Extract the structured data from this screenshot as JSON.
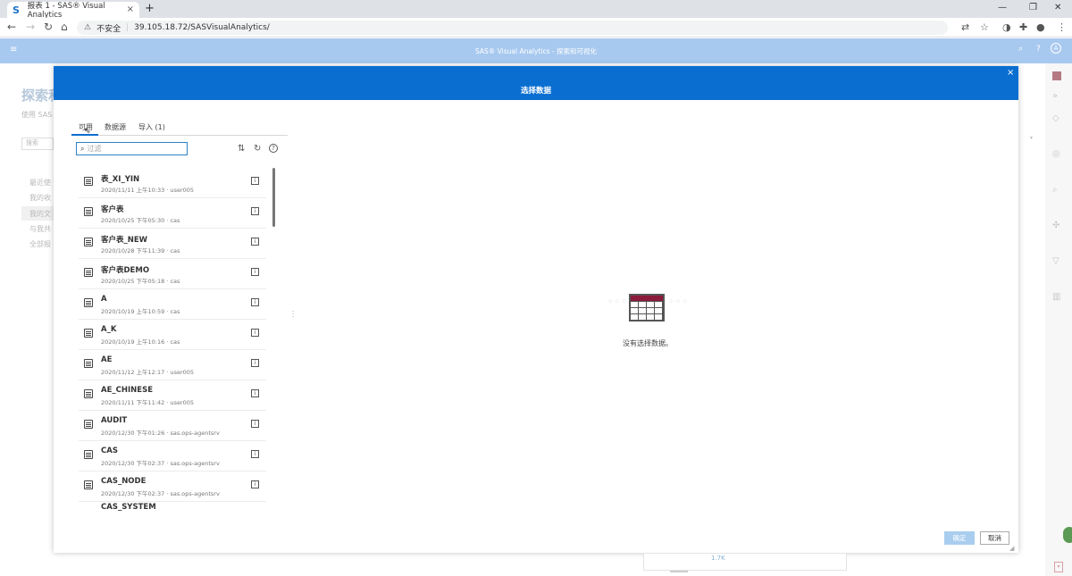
{
  "browser": {
    "tab_title": "报表 1 - SAS® Visual Analytics",
    "tab_close": "×",
    "new_tab": "+",
    "favicon": "S",
    "security_warning": "不安全",
    "url": "39.105.18.72/SASVisualAnalytics/",
    "window_controls": [
      "—",
      "❐",
      "✕"
    ]
  },
  "app": {
    "header_title": "SAS® Visual Analytics - 探索和可视化",
    "background_title": "探索和",
    "background_subtitle": "使用 SAS",
    "background_search": "搜索",
    "background_nav": [
      "最近使",
      "我的收",
      "我的文",
      "与我共",
      "全部报"
    ]
  },
  "dialog": {
    "title": "选择数据",
    "close": "×",
    "tabs": [
      "可用",
      "数据源",
      "导入 (1)"
    ],
    "filter_placeholder": "过滤",
    "rows": [
      {
        "name": "表_XI_YIN",
        "date": "2020/11/11 上午10:33",
        "owner": "user005"
      },
      {
        "name": "客户表",
        "date": "2020/10/25 下午05:30",
        "owner": "cas"
      },
      {
        "name": "客户表_NEW",
        "date": "2020/10/28 下午11:39",
        "owner": "cas"
      },
      {
        "name": "客户表DEMO",
        "date": "2020/10/25 下午05:18",
        "owner": "cas"
      },
      {
        "name": "A",
        "date": "2020/10/19 上午10:59",
        "owner": "cas"
      },
      {
        "name": "A_K",
        "date": "2020/10/19 上午10:16",
        "owner": "cas"
      },
      {
        "name": "AE",
        "date": "2020/11/12 上午12:17",
        "owner": "user005"
      },
      {
        "name": "AE_CHINESE",
        "date": "2020/11/11 下午11:42",
        "owner": "user005"
      },
      {
        "name": "AUDIT",
        "date": "2020/12/30 下午01:26",
        "owner": "sas.ops-agentsrv"
      },
      {
        "name": "CAS",
        "date": "2020/12/30 下午02:37",
        "owner": "sas.ops-agentsrv"
      },
      {
        "name": "CAS_NODE",
        "date": "2020/12/30 下午02:37",
        "owner": "sas.ops-agentsrv"
      },
      {
        "name": "CAS_SYSTEM",
        "date": "",
        "owner": ""
      }
    ],
    "empty_message": "没有选择数据。",
    "ok_label": "确定",
    "cancel_label": "取消"
  },
  "below_value": "1.7K",
  "colors": {
    "accent": "#0a6ed1",
    "app_header": "#a8c9ef"
  }
}
